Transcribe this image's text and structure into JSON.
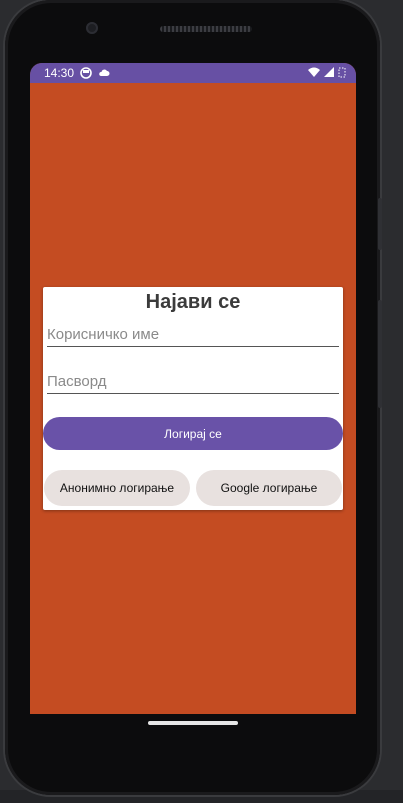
{
  "status_bar": {
    "time": "14:30",
    "icons_left": [
      "face-notification-icon",
      "cloud-icon"
    ],
    "icons_right": [
      "wifi-icon",
      "cellular-signal-icon",
      "battery-icon"
    ],
    "color": "#6750a4"
  },
  "screen": {
    "background_color": "#c44c22"
  },
  "login_card": {
    "title": "Најави се",
    "username_placeholder": "Корисничко име",
    "username_value": "",
    "password_placeholder": "Пасворд",
    "password_value": "",
    "login_button_label": "Логирај се",
    "anonymous_button_label": "Анонимно логирање",
    "google_button_label": "Google логирање",
    "accent_color": "#6952a8"
  }
}
